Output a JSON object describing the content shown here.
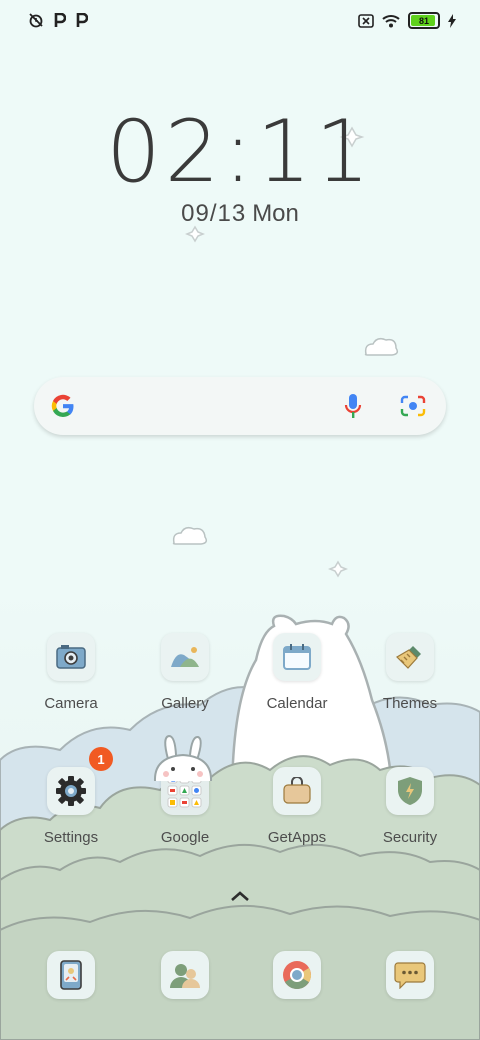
{
  "status_bar": {
    "battery_level": "81",
    "icons": [
      "alarm-off-icon",
      "parking-icon",
      "parking-icon",
      "sim-error-icon",
      "wifi-icon",
      "battery-icon",
      "charging-icon"
    ]
  },
  "clock": {
    "time": "02:11",
    "date": "09/13",
    "day": "Mon"
  },
  "search_bar": {
    "icons": [
      "google-logo-icon",
      "microphone-icon",
      "lens-camera-icon"
    ]
  },
  "apps_row1": [
    {
      "label": "Camera",
      "icon": "camera-icon"
    },
    {
      "label": "Gallery",
      "icon": "gallery-icon"
    },
    {
      "label": "Calendar",
      "icon": "calendar-icon"
    },
    {
      "label": "Themes",
      "icon": "themes-brush-icon"
    }
  ],
  "apps_row2": [
    {
      "label": "Settings",
      "icon": "gear-icon",
      "badge": "1"
    },
    {
      "label": "Google",
      "icon": "folder-icon"
    },
    {
      "label": "GetApps",
      "icon": "shopping-bag-icon"
    },
    {
      "label": "Security",
      "icon": "shield-icon"
    }
  ],
  "dock": [
    {
      "icon": "phone-icon"
    },
    {
      "icon": "contacts-icon"
    },
    {
      "icon": "chrome-icon"
    },
    {
      "icon": "messages-icon"
    }
  ],
  "colors": {
    "accent_badge": "#f15a22",
    "battery_fill": "#5fd11c",
    "hill_front": "#ccdccb",
    "hill_back": "#d5e4ec"
  }
}
